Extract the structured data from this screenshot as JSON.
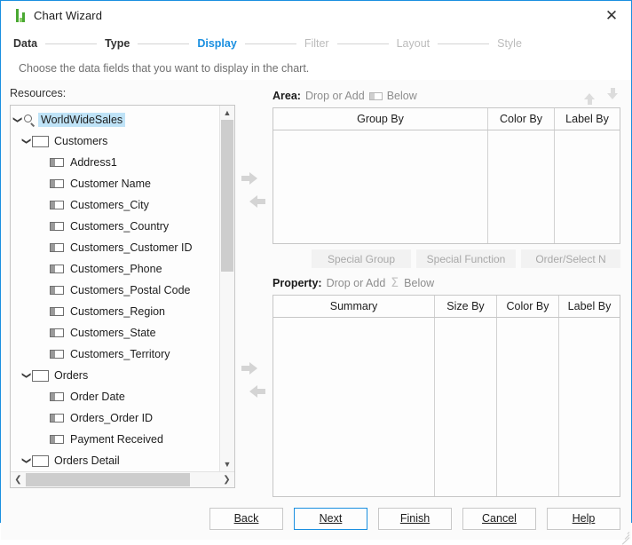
{
  "window": {
    "title": "Chart Wizard",
    "icon": "bar-chart-icon",
    "close_label": "✕"
  },
  "steps": [
    {
      "label": "Data",
      "state": "done"
    },
    {
      "label": "Type",
      "state": "done"
    },
    {
      "label": "Display",
      "state": "active"
    },
    {
      "label": "Filter",
      "state": "todo"
    },
    {
      "label": "Layout",
      "state": "todo"
    },
    {
      "label": "Style",
      "state": "todo"
    }
  ],
  "subtitle": "Choose the data fields that you want to display in the chart.",
  "resources": {
    "label": "Resources:",
    "tree": [
      {
        "label": "WorldWideSales",
        "type": "query",
        "depth": 0,
        "expanded": true,
        "selected": true
      },
      {
        "label": "Customers",
        "type": "table",
        "depth": 1,
        "expanded": true,
        "selected": false
      },
      {
        "label": "Address1",
        "type": "field",
        "depth": 2,
        "selected": false
      },
      {
        "label": "Customer Name",
        "type": "field",
        "depth": 2,
        "selected": false
      },
      {
        "label": "Customers_City",
        "type": "field",
        "depth": 2,
        "selected": false
      },
      {
        "label": "Customers_Country",
        "type": "field",
        "depth": 2,
        "selected": false
      },
      {
        "label": "Customers_Customer ID",
        "type": "field",
        "depth": 2,
        "selected": false
      },
      {
        "label": "Customers_Phone",
        "type": "field",
        "depth": 2,
        "selected": false
      },
      {
        "label": "Customers_Postal Code",
        "type": "field",
        "depth": 2,
        "selected": false
      },
      {
        "label": "Customers_Region",
        "type": "field",
        "depth": 2,
        "selected": false
      },
      {
        "label": "Customers_State",
        "type": "field",
        "depth": 2,
        "selected": false
      },
      {
        "label": "Customers_Territory",
        "type": "field",
        "depth": 2,
        "selected": false
      },
      {
        "label": "Orders",
        "type": "table",
        "depth": 1,
        "expanded": true,
        "selected": false
      },
      {
        "label": "Order Date",
        "type": "field",
        "depth": 2,
        "selected": false
      },
      {
        "label": "Orders_Order ID",
        "type": "field",
        "depth": 2,
        "selected": false
      },
      {
        "label": "Payment Received",
        "type": "field",
        "depth": 2,
        "selected": false
      },
      {
        "label": "Orders Detail",
        "type": "table",
        "depth": 1,
        "expanded": true,
        "selected": false
      }
    ]
  },
  "transfer": {
    "add_area_label": "▶",
    "remove_area_label": "◀",
    "add_property_label": "▶",
    "remove_property_label": "◀"
  },
  "area": {
    "title": "Area:",
    "hint_prefix": "Drop or Add",
    "hint_suffix": "Below",
    "move_up_label": "▲",
    "move_down_label": "▼",
    "columns": [
      "Group By",
      "Color By",
      "Label By"
    ],
    "rows": []
  },
  "special_buttons": [
    "Special Group",
    "Special Function",
    "Order/Select N"
  ],
  "property": {
    "title": "Property:",
    "hint_prefix": "Drop or Add",
    "hint_symbol": "Σ",
    "hint_suffix": "Below",
    "columns": [
      "Summary",
      "Size By",
      "Color By",
      "Label By"
    ],
    "rows": []
  },
  "footer": {
    "buttons": [
      {
        "label": "Back",
        "mnemonic": "B",
        "primary": false
      },
      {
        "label": "Next",
        "mnemonic": "N",
        "primary": true
      },
      {
        "label": "Finish",
        "mnemonic": "F",
        "primary": false
      },
      {
        "label": "Cancel",
        "mnemonic": "C",
        "primary": false
      },
      {
        "label": "Help",
        "mnemonic": "H",
        "primary": false
      }
    ]
  },
  "colors": {
    "accent": "#1a8fe0",
    "selection": "#bfe3f7",
    "disabled_text": "#a8a8a8",
    "border": "#c6c6c6"
  }
}
